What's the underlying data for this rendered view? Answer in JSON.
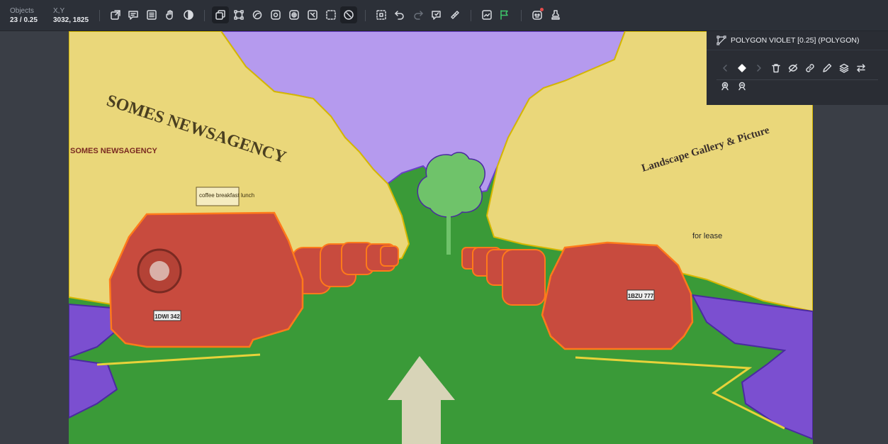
{
  "toolbar": {
    "objects_label": "Objects",
    "objects_value": "23 / 0.25",
    "xy_label": "X,Y",
    "xy_value": "3032, 1825",
    "tools": [
      {
        "icon": "export-icon"
      },
      {
        "icon": "comment-icon"
      },
      {
        "icon": "list-icon"
      },
      {
        "icon": "hand-icon"
      },
      {
        "icon": "contrast-icon"
      },
      {
        "icon": "layers-icon"
      },
      {
        "icon": "polygon-icon"
      },
      {
        "icon": "segment-icon"
      },
      {
        "icon": "brush-icon"
      },
      {
        "icon": "grid-icon"
      },
      {
        "icon": "magic-icon"
      },
      {
        "icon": "box-select-icon"
      },
      {
        "icon": "clock-icon"
      },
      {
        "icon": "select-area-icon"
      },
      {
        "icon": "undo-icon"
      },
      {
        "icon": "redo-icon"
      },
      {
        "icon": "review-icon"
      },
      {
        "icon": "ruler-icon"
      },
      {
        "icon": "chart-icon"
      },
      {
        "icon": "flag-icon"
      },
      {
        "icon": "robot-icon"
      },
      {
        "icon": "stamp-icon"
      }
    ]
  },
  "panel": {
    "title": "POLYGON VIOLET [0.25] (POLYGON)",
    "tools": [
      {
        "icon": "chevron-left-icon"
      },
      {
        "icon": "diamond-icon"
      },
      {
        "icon": "chevron-right-icon"
      },
      {
        "icon": "trash-icon"
      },
      {
        "icon": "hide-icon"
      },
      {
        "icon": "link-icon"
      },
      {
        "icon": "pencil-icon"
      },
      {
        "icon": "stack-icon"
      },
      {
        "icon": "swap-icon"
      },
      {
        "icon": "add-point-icon"
      },
      {
        "icon": "remove-point-icon"
      }
    ]
  },
  "canvas": {
    "signs": {
      "shop_name": "SOMES NEWSAGENCY",
      "shop_name_small": "SOMES NEWSAGENCY",
      "cafe": "coffee breakfast lunch",
      "gallery": "Landscape Gallery & Picture",
      "lease": "for lease",
      "plate_left": "1DWI 342",
      "plate_right": "1BZU 777"
    },
    "classes": {
      "sky": "#b59aee",
      "buildings": "#ead77a",
      "road": "#3a9a38",
      "cars": "#c84b3e",
      "tree": "#6fc36a",
      "sidewalk": "#7b4fd0"
    }
  }
}
